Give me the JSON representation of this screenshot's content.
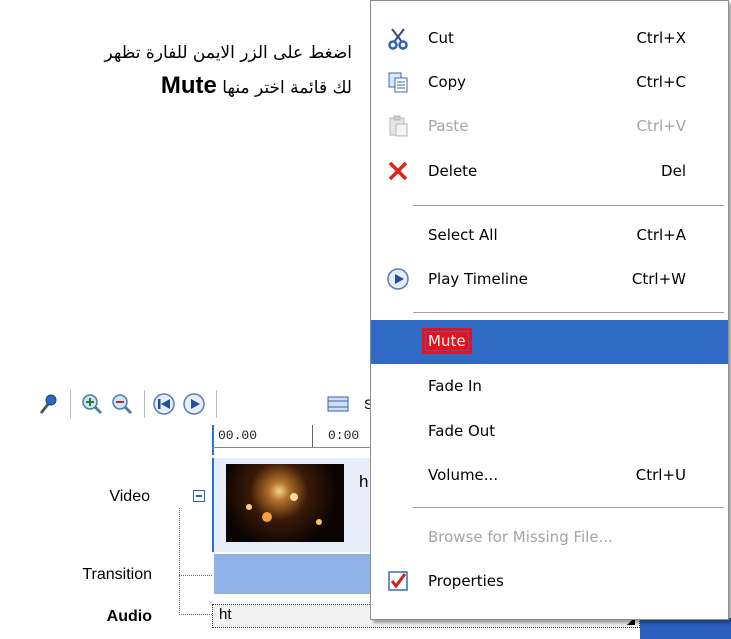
{
  "caption": {
    "line1": "اضغط على الزر الايمن للفارة تظهر",
    "line2_prefix": "لك قائمة اختر منها",
    "line2_keyword": "Mute"
  },
  "toolbar": {
    "icons": [
      "microphone-icon",
      "zoom-in-icon",
      "zoom-out-icon",
      "rewind-icon",
      "play-icon",
      "storyboard-icon"
    ],
    "truncated_label": "S"
  },
  "ruler": {
    "labels": [
      "00.00",
      "0:00"
    ]
  },
  "tracks": {
    "video_label": "Video",
    "transition_label": "Transition",
    "audio_label": "Audio",
    "video_clip_text": "h",
    "audio_clip_text": "ht"
  },
  "context_menu": {
    "items": [
      {
        "label": "Cut",
        "shortcut": "Ctrl+X",
        "icon": "scissors-icon",
        "enabled": true
      },
      {
        "label": "Copy",
        "shortcut": "Ctrl+C",
        "icon": "copy-icon",
        "enabled": true
      },
      {
        "label": "Paste",
        "shortcut": "Ctrl+V",
        "icon": "paste-icon",
        "enabled": false
      },
      {
        "label": "Delete",
        "shortcut": "Del",
        "icon": "delete-x-icon",
        "enabled": true
      },
      {
        "label": "Select All",
        "shortcut": "Ctrl+A",
        "icon": "",
        "enabled": true
      },
      {
        "label": "Play Timeline",
        "shortcut": "Ctrl+W",
        "icon": "play-circle-icon",
        "enabled": true
      },
      {
        "label": "Mute",
        "shortcut": "",
        "icon": "",
        "enabled": true,
        "selected": true
      },
      {
        "label": "Fade In",
        "shortcut": "",
        "icon": "",
        "enabled": true
      },
      {
        "label": "Fade Out",
        "shortcut": "",
        "icon": "",
        "enabled": true
      },
      {
        "label": "Volume...",
        "shortcut": "Ctrl+U",
        "icon": "",
        "enabled": true
      },
      {
        "label": "Browse for Missing File...",
        "shortcut": "",
        "icon": "",
        "enabled": false
      },
      {
        "label": "Properties",
        "shortcut": "",
        "icon": "properties-check-icon",
        "enabled": true
      }
    ]
  },
  "colors": {
    "menu_highlight": "#316ac5",
    "mute_highlight_box": "#e8101a",
    "timeline_blue": "#8fb0e8"
  }
}
